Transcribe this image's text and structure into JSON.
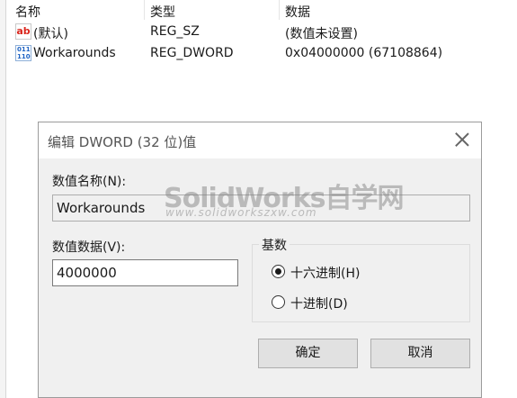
{
  "list": {
    "headers": {
      "name": "名称",
      "type": "类型",
      "data": "数据"
    },
    "rows": [
      {
        "icon": "string-value-icon",
        "icon_text": "ab",
        "name": "(默认)",
        "type": "REG_SZ",
        "data": "(数值未设置)"
      },
      {
        "icon": "binary-value-icon",
        "icon_text": "",
        "name": "Workarounds",
        "type": "REG_DWORD",
        "data": "0x04000000 (67108864)"
      }
    ]
  },
  "dialog": {
    "title": "编辑 DWORD (32 位)值",
    "value_name_label": "数值名称(N):",
    "value_name": "Workarounds",
    "value_data_label": "数值数据(V):",
    "value_data": "4000000",
    "base": {
      "title": "基数",
      "options": [
        {
          "label": "十六进制(H)",
          "checked": true
        },
        {
          "label": "十进制(D)",
          "checked": false
        }
      ]
    },
    "ok_label": "确定",
    "cancel_label": "取消"
  },
  "watermark": {
    "main": "SolidWorks自学网",
    "sub": "www.solidworkszxw.com"
  }
}
